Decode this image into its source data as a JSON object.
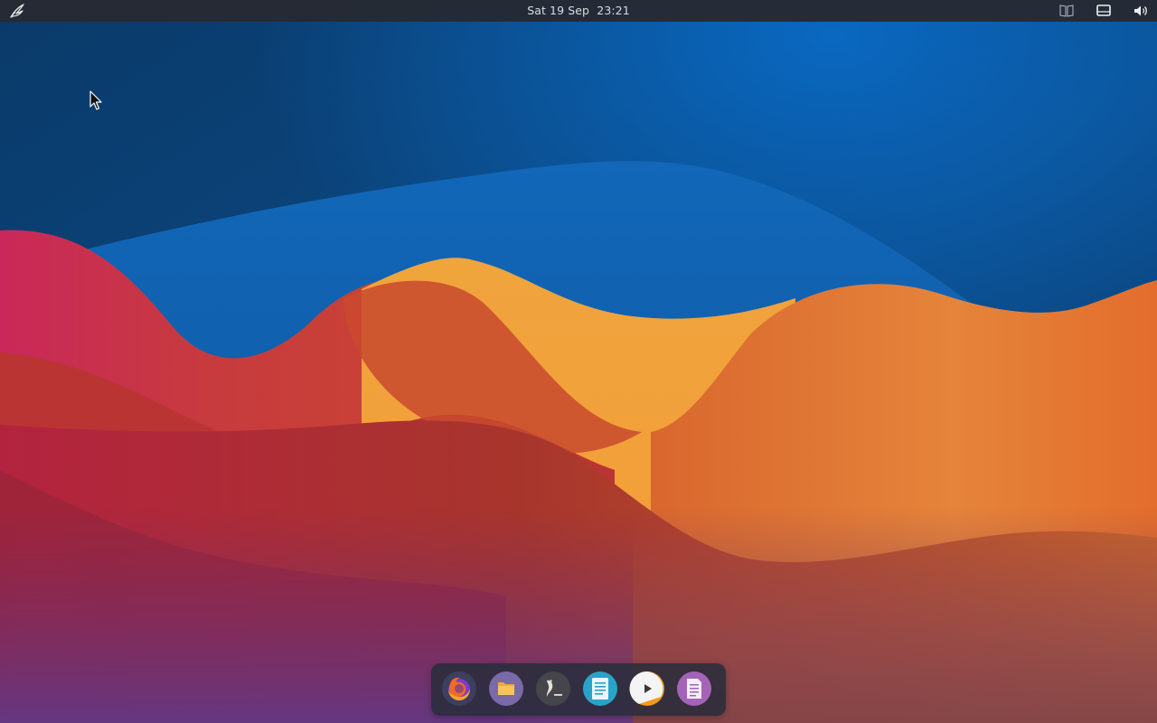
{
  "top_panel": {
    "clock_date": "Sat 19 Sep",
    "clock_time": "23:21",
    "menu_icon": "feather-menu-icon",
    "tray": [
      {
        "name": "keyboard-layout-icon"
      },
      {
        "name": "display-icon"
      },
      {
        "name": "volume-icon"
      }
    ]
  },
  "dock": {
    "items": [
      {
        "app": "firefox",
        "icon": "firefox-icon"
      },
      {
        "app": "files",
        "icon": "folder-icon"
      },
      {
        "app": "terminal",
        "icon": "terminal-icon"
      },
      {
        "app": "text-editor",
        "icon": "text-editor-icon"
      },
      {
        "app": "media-player",
        "icon": "media-player-icon"
      },
      {
        "app": "document-viewer",
        "icon": "document-viewer-icon"
      }
    ]
  },
  "colors": {
    "panel_bg": "#262a32",
    "dock_bg": "#282c3a",
    "sky_dark": "#0b3e70",
    "sky_mid": "#1565b5",
    "wave_red": "#c73243",
    "wave_orange": "#e0782f",
    "wave_yellow": "#f2a03a",
    "bottom_purple": "#5a3b8c"
  }
}
